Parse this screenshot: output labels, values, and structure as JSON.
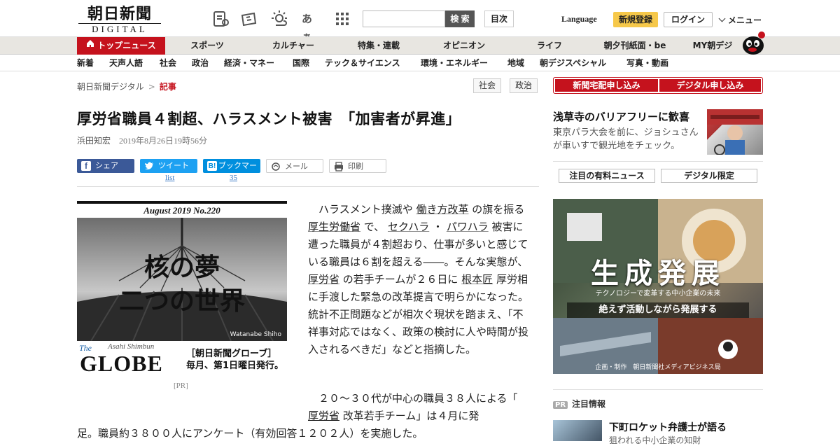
{
  "header": {
    "logo_top": "朝日新聞",
    "logo_bottom": "DIGITAL",
    "icon_kana": "あぁ",
    "search_placeholder": "",
    "search_label": "検 索",
    "toc_label": "目次",
    "language_label": "Language",
    "register_label": "新規登録",
    "login_label": "ログイン",
    "menu_label": "メニュー"
  },
  "nav_primary": [
    {
      "label": "トップニュース",
      "active": true
    },
    {
      "label": "スポーツ"
    },
    {
      "label": "カルチャー"
    },
    {
      "label": "特集・連載"
    },
    {
      "label": "オピニオン"
    },
    {
      "label": "ライフ"
    },
    {
      "label": "朝夕刊紙面・be"
    },
    {
      "label": "MY朝デジ"
    }
  ],
  "nav_secondary": [
    "新着",
    "天声人語",
    "社会",
    "政治",
    "経済・マネー",
    "国際",
    "テック＆サイエンス",
    "環境・エネルギー",
    "地域",
    "朝デジスペシャル",
    "写真・動画"
  ],
  "breadcrumb": {
    "home": "朝日新聞デジタル",
    "sep": ">",
    "current": "記事"
  },
  "tags": [
    "社会",
    "政治"
  ],
  "article": {
    "headline": "厚労省職員４割超、ハラスメント被害　「加害者が昇進」",
    "author": "浜田知宏",
    "date": "2019年8月26日19時56分",
    "share": {
      "facebook": "シェア",
      "twitter": "ツイート",
      "hatena": "ブックマーク",
      "mail": "メール",
      "print": "印刷",
      "twitter_count": "list",
      "hatena_count": "35"
    },
    "para1": {
      "t1": "ハラスメント撲滅や",
      "l1": "働き方改革",
      "t2": "の旗を振る",
      "l2": "厚生労働省",
      "t3": "で、",
      "l3": "セクハラ",
      "t4": "・",
      "l4": "パワハラ",
      "t5": "被害に遭った職員が４割超おり、仕事が多いと感じている職員は６割を超える――。そんな実態が、",
      "l5": "厚労省",
      "t6": "の若手チームが２６日に",
      "l6": "根本匠",
      "t7": "厚労相に手渡した緊急の改革提言で明らかになった。統計不正問題などが相次ぐ現状を踏まえ、「不祥事対応ではなく、政策の検討に人や時間が投入されるべきだ」などと指摘した。"
    },
    "para2_first": "２０～３０代が中心の職員３８人による「",
    "para2_link": "厚労省",
    "para2_mid": "改革若手チーム」は４月に発",
    "para2_line2": "足。職員約３８００人にアンケート（有効回答１２０２人）を実施した。"
  },
  "ad_left": {
    "issue": "August  2019  No.220",
    "title_line1": "核の夢",
    "title_line2": "二つの世界",
    "credit": "Watanabe Shiho",
    "brand_small": "The",
    "brand_sub": "Asahi Shimbun",
    "brand": "GLOBE",
    "desc_line1": "［朝日新聞グローブ］",
    "desc_line2": "毎月、第1日曜日発行。",
    "pr": "[PR]"
  },
  "sidebar": {
    "sub_delivery": "新聞宅配申し込み",
    "sub_digital": "デジタル申し込み",
    "feature_title": "浅草寺のバリアフリーに歓喜",
    "feature_desc": "東京パラ大会を前に、ジョシュさんが車いすで観光地をチェック。",
    "tab_paid": "注目の有料ニュース",
    "tab_digital": "デジタル限定",
    "ad_main": "生成発展",
    "ad_sub": "テクノロジーで変革する中小企業の未来",
    "ad_band": "絶えず活動しながら発展する",
    "ad_foot": "企画・制作　朝日新聞社メディアビジネス局",
    "pr_tag": "PR",
    "pr_heading": "注目情報",
    "news_title": "下町ロケット弁護士が語る",
    "news_sub": "狙われる中小企業の知財"
  },
  "colors": {
    "brand_red": "#c5121d",
    "register_yellow": "#f6c84a",
    "facebook": "#3b5998",
    "twitter": "#1da1f2",
    "hatena": "#008fde"
  }
}
